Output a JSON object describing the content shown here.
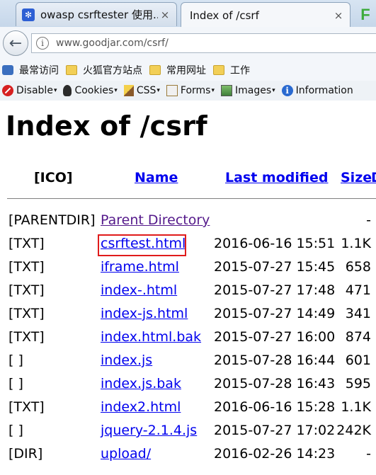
{
  "browser": {
    "tabs": [
      {
        "title": "owasp csrftester 使用...",
        "close": "×"
      },
      {
        "title": "Index of /csrf",
        "close": "×"
      }
    ],
    "address": {
      "url": "www.goodjar.com/csrf/"
    },
    "bookmarks": [
      "最常访问",
      "火狐官方站点",
      "常用网址",
      "工作"
    ],
    "devtoolbar": [
      "Disable",
      "Cookies",
      "CSS",
      "Forms",
      "Images",
      "Information"
    ]
  },
  "page": {
    "title": "Index of /csrf",
    "headers": {
      "icon": "[ICO]",
      "name": "Name",
      "modified": "Last modified",
      "size": "Size",
      "desc": "D"
    },
    "rows": [
      {
        "icon": "[PARENTDIR]",
        "name": "Parent Directory",
        "date": "",
        "size": "-"
      },
      {
        "icon": "[TXT]",
        "name": "csrftest.html",
        "date": "2016-06-16 15:51",
        "size": "1.1K"
      },
      {
        "icon": "[TXT]",
        "name": "iframe.html",
        "date": "2015-07-27 15:45",
        "size": "658"
      },
      {
        "icon": "[TXT]",
        "name": "index-.html",
        "date": "2015-07-27 17:48",
        "size": "471"
      },
      {
        "icon": "[TXT]",
        "name": "index-js.html",
        "date": "2015-07-27 14:49",
        "size": "341"
      },
      {
        "icon": "[TXT]",
        "name": "index.html.bak",
        "date": "2015-07-27 16:00",
        "size": "874"
      },
      {
        "icon": "[ ]",
        "name": "index.js",
        "date": "2015-07-28 16:44",
        "size": "601"
      },
      {
        "icon": "[ ]",
        "name": "index.js.bak",
        "date": "2015-07-28 16:43",
        "size": "595"
      },
      {
        "icon": "[TXT]",
        "name": "index2.html",
        "date": "2016-06-16 15:28",
        "size": "1.1K"
      },
      {
        "icon": "[ ]",
        "name": "jquery-2.1.4.js",
        "date": "2015-07-27 17:02",
        "size": "242K"
      },
      {
        "icon": "[DIR]",
        "name": "upload/",
        "date": "2016-02-26 14:23",
        "size": "-"
      }
    ]
  },
  "colors": {
    "link": "#0000ee",
    "visited": "#551a8b",
    "highlight": "#e01b1b"
  }
}
